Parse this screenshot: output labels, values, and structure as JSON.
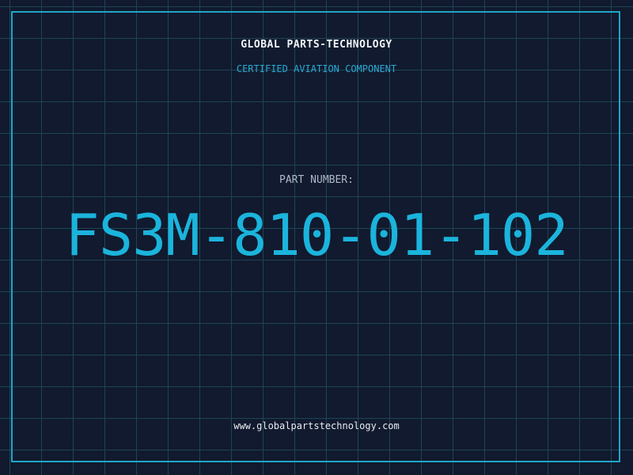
{
  "header": {
    "company_name": "GLOBAL PARTS-TECHNOLOGY",
    "tagline": "CERTIFIED AVIATION COMPONENT"
  },
  "part": {
    "label": "PART NUMBER:",
    "number": "FS3M-810-01-102"
  },
  "footer": {
    "website": "www.globalpartstechnology.com"
  },
  "colors": {
    "background": "#111a2e",
    "grid": "#1e4458",
    "accent": "#1bb4dc",
    "frame": "#1fa6c8"
  }
}
